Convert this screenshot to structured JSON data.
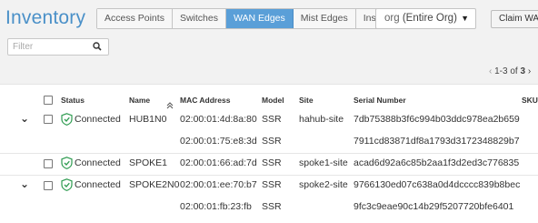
{
  "page": {
    "title": "Inventory"
  },
  "tabs": [
    {
      "label": "Access Points",
      "active": false
    },
    {
      "label": "Switches",
      "active": false
    },
    {
      "label": "WAN Edges",
      "active": true
    },
    {
      "label": "Mist Edges",
      "active": false
    },
    {
      "label": "Installed Base",
      "active": false
    }
  ],
  "org_select": {
    "prefix": "org",
    "value": "(Entire Org)"
  },
  "claim_button": {
    "label": "Claim WAN"
  },
  "filter": {
    "placeholder": "Filter"
  },
  "pagination": {
    "range": "1-3",
    "of": "of",
    "total": "3"
  },
  "table": {
    "columns": {
      "status": "Status",
      "name": "Name",
      "mac": "MAC Address",
      "model": "Model",
      "site": "Site",
      "serial": "Serial Number",
      "sku": "SKU"
    },
    "rows": [
      {
        "status": "Connected",
        "name": "HUB1N0",
        "mac": "02:00:01:4d:8a:80",
        "model": "SSR",
        "site": "hahub-site",
        "serial": "7db75388b3f6c994b03ddc978ea2b659"
      },
      {
        "status": "",
        "name": "",
        "mac": "02:00:01:75:e8:3d",
        "model": "SSR",
        "site": "",
        "serial": "7911cd83871df8a1793d3172348829b7"
      },
      {
        "status": "Connected",
        "name": "SPOKE1",
        "mac": "02:00:01:66:ad:7d",
        "model": "SSR",
        "site": "spoke1-site",
        "serial": "acad6d92a6c85b2aa1f3d2ed3c776835"
      },
      {
        "status": "Connected",
        "name": "SPOKE2N0",
        "mac": "02:00:01:ee:70:b7",
        "model": "SSR",
        "site": "spoke2-site",
        "serial": "9766130ed07c638a0d4dcccc839b8bec"
      },
      {
        "status": "",
        "name": "",
        "mac": "02:00:01:fb:23:fb",
        "model": "SSR",
        "site": "",
        "serial": "9fc3c9eae90c14b29f5207720bfe6401"
      }
    ]
  },
  "colors": {
    "accent": "#4a90c8",
    "tab_active_bg": "#5a9fd8",
    "connected": "#2e9b50"
  }
}
